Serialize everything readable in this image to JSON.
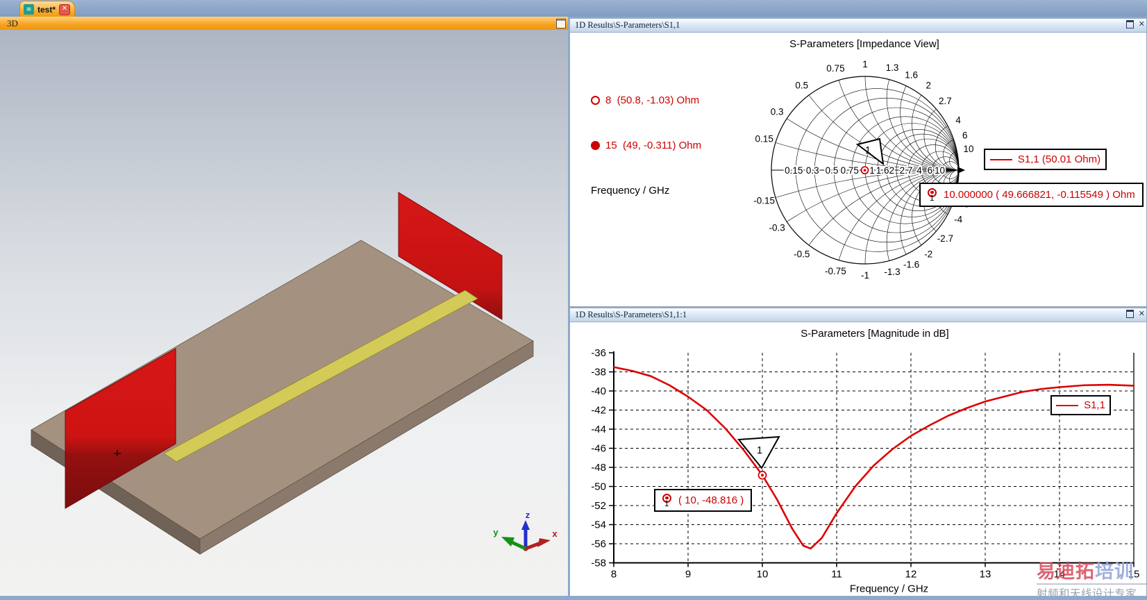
{
  "tab_bar": {
    "tab_label": "test*"
  },
  "left_pane": {
    "title": "3D",
    "axis_triad": {
      "x": "x",
      "y": "y",
      "z": "z"
    }
  },
  "smith_panel": {
    "window_title": "1D Results\\S-Parameters\\S1,1",
    "chart_title": "S-Parameters [Impedance View]",
    "marker_readouts": [
      {
        "style": "open",
        "text": "8  (50.8, -1.03) Ohm"
      },
      {
        "style": "filled",
        "text": "15  (49, -0.311) Ohm"
      }
    ],
    "axis_caption": "Frequency / GHz",
    "legend_label": "S1,1 (50.01 Ohm)",
    "marker_flag": "1",
    "marker_box": {
      "index": "1",
      "text": "10.000000 ( 49.666821, -0.115549 ) Ohm"
    }
  },
  "mag_panel": {
    "window_title": "1D Results\\S-Parameters\\S1,1:1",
    "chart_title": "S-Parameters [Magnitude in dB]",
    "legend_label": "S1,1",
    "xlabel": "Frequency / GHz",
    "marker_flag": "1",
    "marker_box": {
      "index": "1",
      "text": "( 10, -48.816 )"
    }
  },
  "watermark": {
    "title_red": "易迪拓",
    "title_blue": "培训",
    "subtitle": "射频和天线设计专家"
  },
  "colors": {
    "trace_red": "#dd0000",
    "text_red": "#cc0000",
    "accent_orange": "#f6a21f",
    "desktop_blue": "#8ea9ca",
    "substrate_tan": "#a5917f",
    "strip_yellow": "#d3ca58",
    "port_red": "#d21414"
  },
  "chart_data": [
    {
      "type": "smith",
      "title": "S-Parameters [Impedance View]",
      "freq_unit": "GHz",
      "series": [
        {
          "name": "S1,1",
          "reference_impedance_ohm": 50.01,
          "points_ohm": [
            {
              "freq_ghz": 8,
              "re": 50.8,
              "im": -1.03
            },
            {
              "freq_ghz": 10,
              "re": 49.666821,
              "im": -0.115549
            },
            {
              "freq_ghz": 15,
              "re": 49,
              "im": -0.311
            }
          ]
        }
      ],
      "markers": [
        {
          "n": "1",
          "freq_ghz": 10,
          "re_ohm": 49.666821,
          "im_ohm": -0.115549
        }
      ],
      "resistance_ticks": [
        0.15,
        0.3,
        0.5,
        0.75,
        1,
        1.3,
        1.6,
        2,
        2.7,
        4,
        6,
        10
      ],
      "reactance_ticks": [
        0.15,
        0.3,
        0.5,
        0.75,
        1,
        1.3,
        1.6,
        2,
        2.7,
        4,
        6,
        10
      ],
      "axis_labels": [
        "0.15",
        "0.3",
        "0.5",
        "0.75",
        "1",
        "1.62",
        "2.7",
        "4",
        "6",
        "10"
      ]
    },
    {
      "type": "line",
      "title": "S-Parameters [Magnitude in dB]",
      "xlabel": "Frequency / GHz",
      "xlim": [
        8,
        15
      ],
      "ylim": [
        -58,
        -36
      ],
      "xticks": [
        8,
        9,
        10,
        11,
        12,
        13,
        14,
        15
      ],
      "yticks": [
        -36,
        -38,
        -40,
        -42,
        -44,
        -46,
        -48,
        -50,
        -52,
        -54,
        -56,
        -58
      ],
      "grid": "dashed",
      "legend_position": "upper right",
      "series": [
        {
          "name": "S1,1",
          "color": "#dd0000",
          "points": [
            [
              8,
              -37.5
            ],
            [
              8.25,
              -37.9
            ],
            [
              8.5,
              -38.45
            ],
            [
              8.75,
              -39.4
            ],
            [
              9,
              -40.6
            ],
            [
              9.25,
              -42.0
            ],
            [
              9.5,
              -43.9
            ],
            [
              9.75,
              -46.2
            ],
            [
              10,
              -48.816
            ],
            [
              10.2,
              -51.4
            ],
            [
              10.4,
              -54.4
            ],
            [
              10.55,
              -56.2
            ],
            [
              10.65,
              -56.5
            ],
            [
              10.8,
              -55.4
            ],
            [
              11,
              -52.8
            ],
            [
              11.25,
              -50.0
            ],
            [
              11.5,
              -47.8
            ],
            [
              11.75,
              -46.1
            ],
            [
              12,
              -44.7
            ],
            [
              12.25,
              -43.6
            ],
            [
              12.5,
              -42.6
            ],
            [
              12.75,
              -41.8
            ],
            [
              13,
              -41.1
            ],
            [
              13.25,
              -40.6
            ],
            [
              13.5,
              -40.1
            ],
            [
              13.75,
              -39.8
            ],
            [
              14,
              -39.6
            ],
            [
              14.33,
              -39.4
            ],
            [
              14.66,
              -39.35
            ],
            [
              15,
              -39.45
            ]
          ]
        }
      ],
      "marker": {
        "n": "1",
        "x": 10,
        "y": -48.816
      }
    }
  ]
}
